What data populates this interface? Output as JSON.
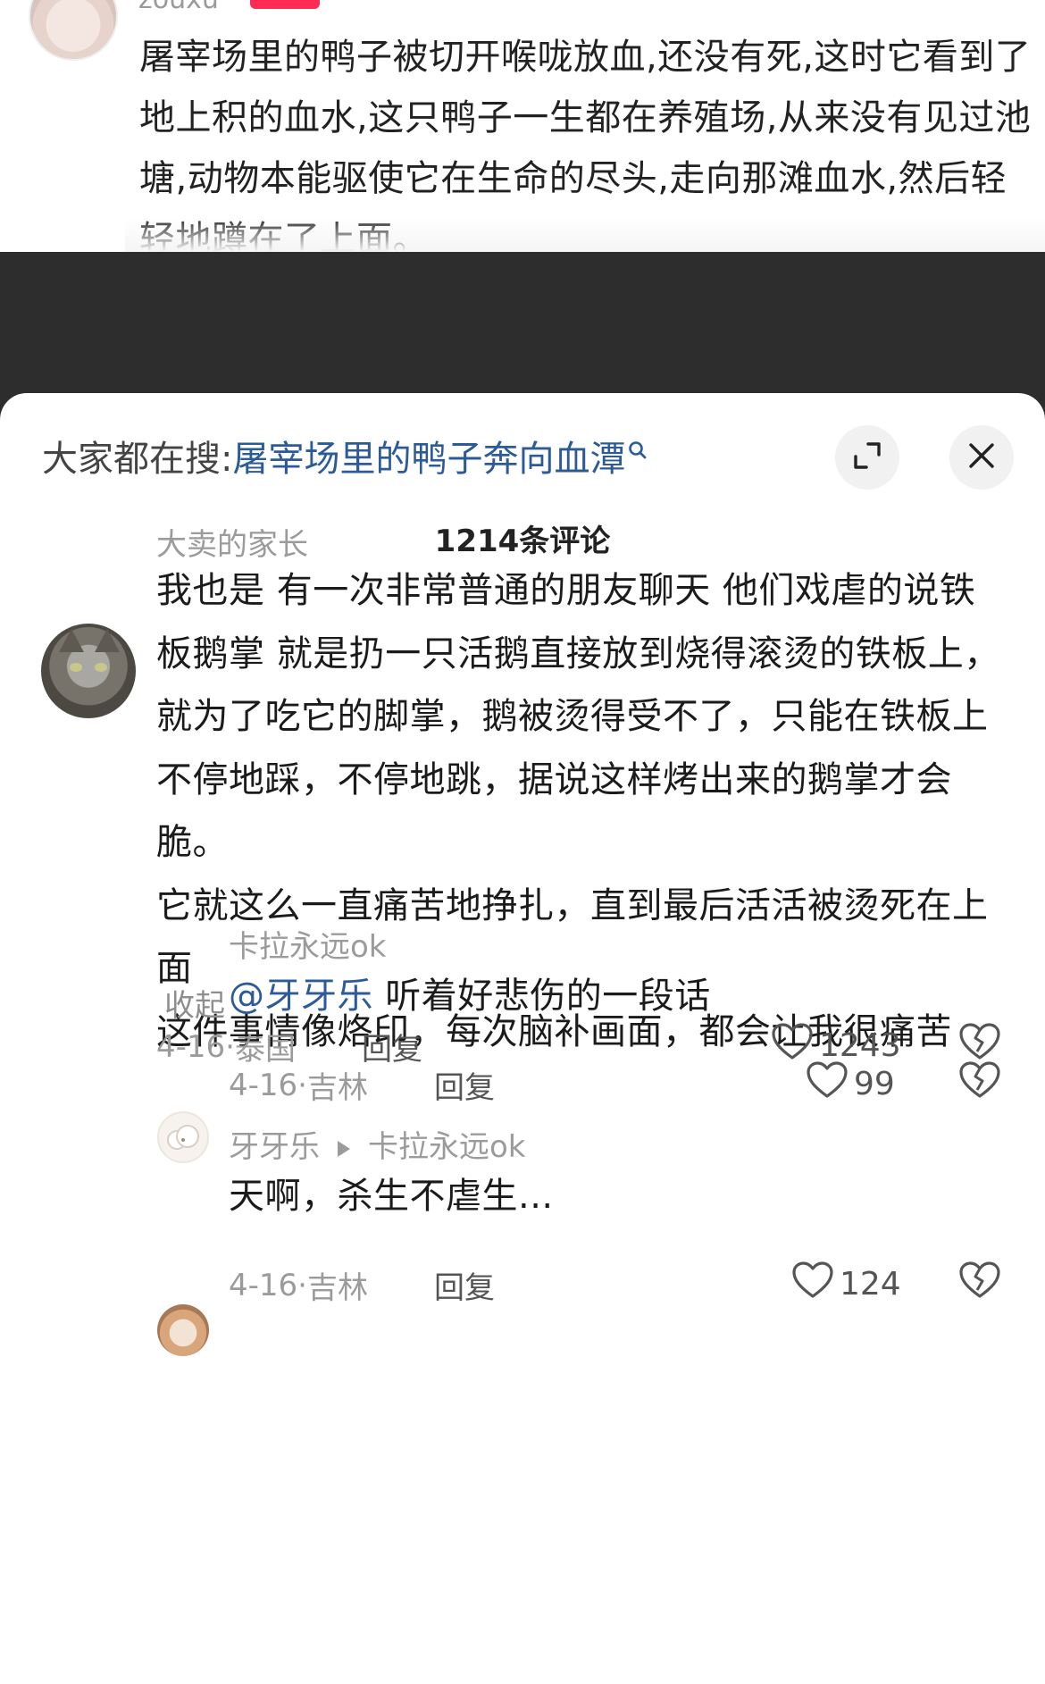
{
  "top_post": {
    "author": "zouxu",
    "text": "屠宰场里的鸭子被切开喉咙放血,还没有死,这时它看到了地上积的血水,这只鸭子一生都在养殖场,从来没有见过池塘,动物本能驱使它在生命的尽头,走向那滩血水,然后轻轻地蹲在了上面。"
  },
  "sheet": {
    "search_prefix": "大家都在搜:",
    "search_query": "屠宰场里的鸭子奔向血潭",
    "search_icon": "search-icon",
    "expand_icon": "expand-icon",
    "close_icon": "close-icon",
    "comment_count": "1214条评论"
  },
  "comments": [
    {
      "name": "大卖的家长",
      "avatar": "cat-avatar",
      "paragraphs": [
        "我也是 有一次非常普通的朋友聊天 他们戏虐的说铁板鹅掌 就是扔一只活鹅直接放到烧得滚烫的铁板上，就为了吃它的脚掌，鹅被烫得受不了，只能在铁板上不停地踩，不停地跳，据说这样烤出来的鹅掌才会脆。",
        "它就这么一直痛苦地挣扎，直到最后活活被烫死在上面",
        "这件事情像烙印，每次脑补画面，都会让我很痛苦"
      ],
      "collapse_label": "收起",
      "date": "4-16",
      "location": "泰国",
      "reply_label": "回复",
      "likes": "1243"
    }
  ],
  "replies": [
    {
      "name": "卡拉永远ok",
      "mention": "@牙牙乐",
      "text": " 听着好悲伤的一段话",
      "date": "4-16",
      "location": "吉林",
      "reply_label": "回复",
      "likes": "99"
    },
    {
      "name": "牙牙乐",
      "reply_to": "卡拉永远ok",
      "text": "天啊，杀生不虐生...",
      "date": "4-16",
      "location": "吉林",
      "reply_label": "回复",
      "likes": "124"
    }
  ],
  "colors": {
    "link_blue": "#2d5b98",
    "overlay": "#2d2d2d",
    "badge_red": "#fe2c55"
  }
}
